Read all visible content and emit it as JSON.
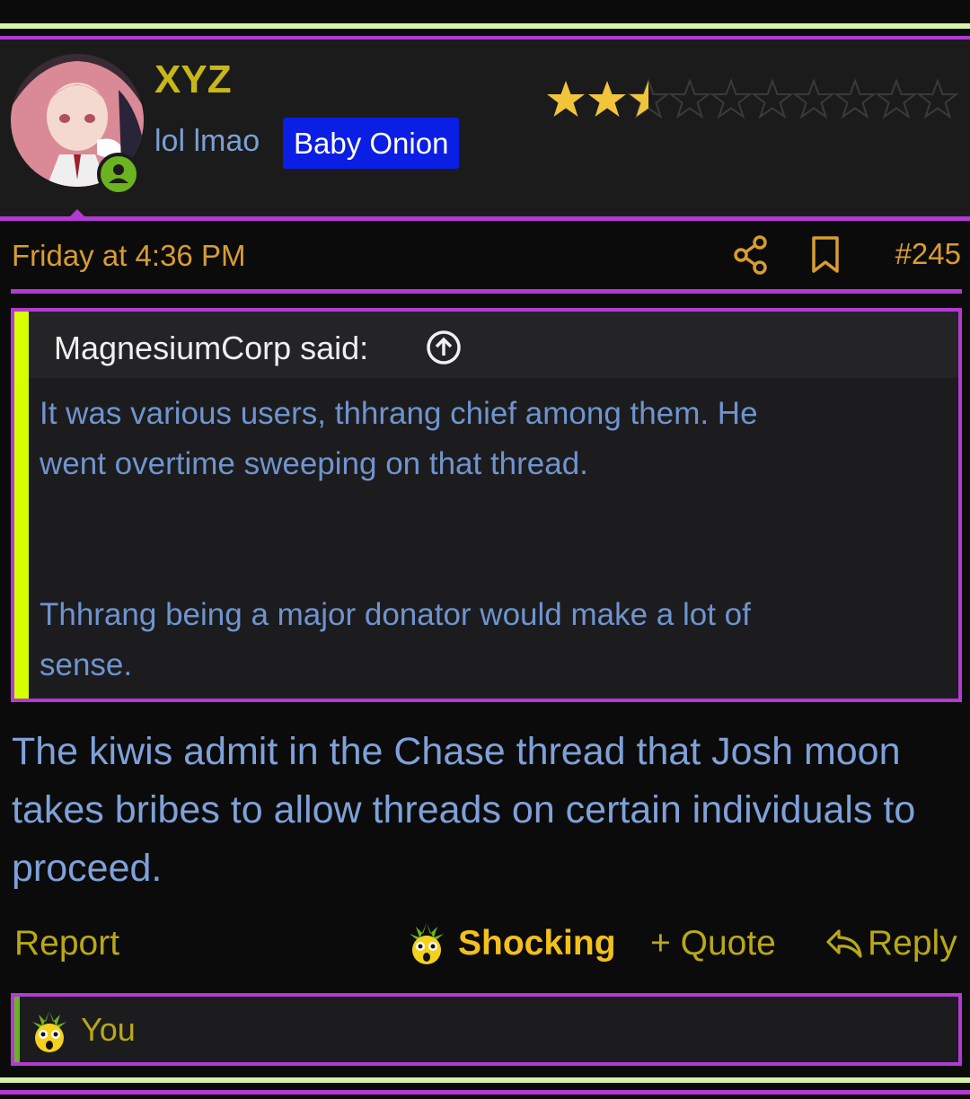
{
  "post": {
    "username": "XYZ",
    "user_title": "lol lmao",
    "badge": "Baby Onion",
    "rating": {
      "value": 2.5,
      "max": 10
    },
    "date": "Friday at 4:36 PM",
    "number": "#245",
    "body": "The kiwis admit in the Chase thread that Josh moon takes bribes to allow threads on certain individuals to proceed."
  },
  "quote": {
    "author": "MagnesiumCorp said:",
    "paragraph1_line1": "It was various users, thhrang chief among them. He",
    "paragraph1_line2": "went overtime sweeping on that thread.",
    "paragraph2_line1": "Thhrang being a major donator would make a lot of",
    "paragraph2_line2": "sense."
  },
  "actions": {
    "report": "Report",
    "reaction": "Shocking",
    "quote": "+ Quote",
    "reply": "Reply"
  },
  "reactions": {
    "who": "You"
  },
  "colors": {
    "accent_border": "#b33ad3",
    "quote_bar": "#d7ff00",
    "username": "#c7b818",
    "badge_bg": "#0b1ee3",
    "link_blue": "#7ea1d8",
    "meta_orange": "#d99c30",
    "online": "#6bb41f"
  },
  "icons": {
    "share": "share-icon",
    "bookmark": "bookmark-icon",
    "quote_up": "arrow-up-circle-icon",
    "reply": "reply-arrow-icon",
    "reaction": "shocked-onion-emoji"
  }
}
